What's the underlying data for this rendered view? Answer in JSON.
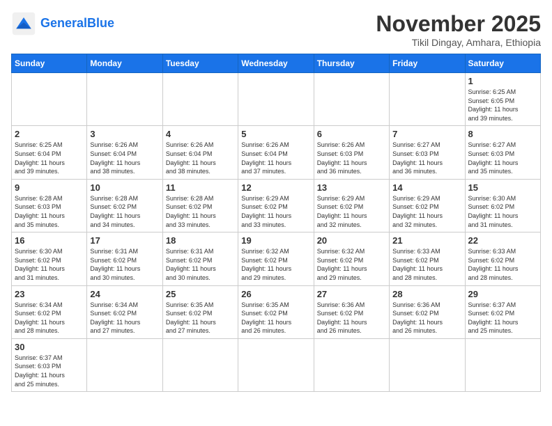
{
  "header": {
    "logo_general": "General",
    "logo_blue": "Blue",
    "month": "November 2025",
    "location": "Tikil Dingay, Amhara, Ethiopia"
  },
  "weekdays": [
    "Sunday",
    "Monday",
    "Tuesday",
    "Wednesday",
    "Thursday",
    "Friday",
    "Saturday"
  ],
  "weeks": [
    [
      {
        "day": "",
        "info": ""
      },
      {
        "day": "",
        "info": ""
      },
      {
        "day": "",
        "info": ""
      },
      {
        "day": "",
        "info": ""
      },
      {
        "day": "",
        "info": ""
      },
      {
        "day": "",
        "info": ""
      },
      {
        "day": "1",
        "info": "Sunrise: 6:25 AM\nSunset: 6:05 PM\nDaylight: 11 hours\nand 39 minutes."
      }
    ],
    [
      {
        "day": "2",
        "info": "Sunrise: 6:25 AM\nSunset: 6:04 PM\nDaylight: 11 hours\nand 39 minutes."
      },
      {
        "day": "3",
        "info": "Sunrise: 6:26 AM\nSunset: 6:04 PM\nDaylight: 11 hours\nand 38 minutes."
      },
      {
        "day": "4",
        "info": "Sunrise: 6:26 AM\nSunset: 6:04 PM\nDaylight: 11 hours\nand 38 minutes."
      },
      {
        "day": "5",
        "info": "Sunrise: 6:26 AM\nSunset: 6:04 PM\nDaylight: 11 hours\nand 37 minutes."
      },
      {
        "day": "6",
        "info": "Sunrise: 6:26 AM\nSunset: 6:03 PM\nDaylight: 11 hours\nand 36 minutes."
      },
      {
        "day": "7",
        "info": "Sunrise: 6:27 AM\nSunset: 6:03 PM\nDaylight: 11 hours\nand 36 minutes."
      },
      {
        "day": "8",
        "info": "Sunrise: 6:27 AM\nSunset: 6:03 PM\nDaylight: 11 hours\nand 35 minutes."
      }
    ],
    [
      {
        "day": "9",
        "info": "Sunrise: 6:28 AM\nSunset: 6:03 PM\nDaylight: 11 hours\nand 35 minutes."
      },
      {
        "day": "10",
        "info": "Sunrise: 6:28 AM\nSunset: 6:02 PM\nDaylight: 11 hours\nand 34 minutes."
      },
      {
        "day": "11",
        "info": "Sunrise: 6:28 AM\nSunset: 6:02 PM\nDaylight: 11 hours\nand 33 minutes."
      },
      {
        "day": "12",
        "info": "Sunrise: 6:29 AM\nSunset: 6:02 PM\nDaylight: 11 hours\nand 33 minutes."
      },
      {
        "day": "13",
        "info": "Sunrise: 6:29 AM\nSunset: 6:02 PM\nDaylight: 11 hours\nand 32 minutes."
      },
      {
        "day": "14",
        "info": "Sunrise: 6:29 AM\nSunset: 6:02 PM\nDaylight: 11 hours\nand 32 minutes."
      },
      {
        "day": "15",
        "info": "Sunrise: 6:30 AM\nSunset: 6:02 PM\nDaylight: 11 hours\nand 31 minutes."
      }
    ],
    [
      {
        "day": "16",
        "info": "Sunrise: 6:30 AM\nSunset: 6:02 PM\nDaylight: 11 hours\nand 31 minutes."
      },
      {
        "day": "17",
        "info": "Sunrise: 6:31 AM\nSunset: 6:02 PM\nDaylight: 11 hours\nand 30 minutes."
      },
      {
        "day": "18",
        "info": "Sunrise: 6:31 AM\nSunset: 6:02 PM\nDaylight: 11 hours\nand 30 minutes."
      },
      {
        "day": "19",
        "info": "Sunrise: 6:32 AM\nSunset: 6:02 PM\nDaylight: 11 hours\nand 29 minutes."
      },
      {
        "day": "20",
        "info": "Sunrise: 6:32 AM\nSunset: 6:02 PM\nDaylight: 11 hours\nand 29 minutes."
      },
      {
        "day": "21",
        "info": "Sunrise: 6:33 AM\nSunset: 6:02 PM\nDaylight: 11 hours\nand 28 minutes."
      },
      {
        "day": "22",
        "info": "Sunrise: 6:33 AM\nSunset: 6:02 PM\nDaylight: 11 hours\nand 28 minutes."
      }
    ],
    [
      {
        "day": "23",
        "info": "Sunrise: 6:34 AM\nSunset: 6:02 PM\nDaylight: 11 hours\nand 28 minutes."
      },
      {
        "day": "24",
        "info": "Sunrise: 6:34 AM\nSunset: 6:02 PM\nDaylight: 11 hours\nand 27 minutes."
      },
      {
        "day": "25",
        "info": "Sunrise: 6:35 AM\nSunset: 6:02 PM\nDaylight: 11 hours\nand 27 minutes."
      },
      {
        "day": "26",
        "info": "Sunrise: 6:35 AM\nSunset: 6:02 PM\nDaylight: 11 hours\nand 26 minutes."
      },
      {
        "day": "27",
        "info": "Sunrise: 6:36 AM\nSunset: 6:02 PM\nDaylight: 11 hours\nand 26 minutes."
      },
      {
        "day": "28",
        "info": "Sunrise: 6:36 AM\nSunset: 6:02 PM\nDaylight: 11 hours\nand 26 minutes."
      },
      {
        "day": "29",
        "info": "Sunrise: 6:37 AM\nSunset: 6:02 PM\nDaylight: 11 hours\nand 25 minutes."
      }
    ],
    [
      {
        "day": "30",
        "info": "Sunrise: 6:37 AM\nSunset: 6:03 PM\nDaylight: 11 hours\nand 25 minutes."
      },
      {
        "day": "",
        "info": ""
      },
      {
        "day": "",
        "info": ""
      },
      {
        "day": "",
        "info": ""
      },
      {
        "day": "",
        "info": ""
      },
      {
        "day": "",
        "info": ""
      },
      {
        "day": "",
        "info": ""
      }
    ]
  ]
}
